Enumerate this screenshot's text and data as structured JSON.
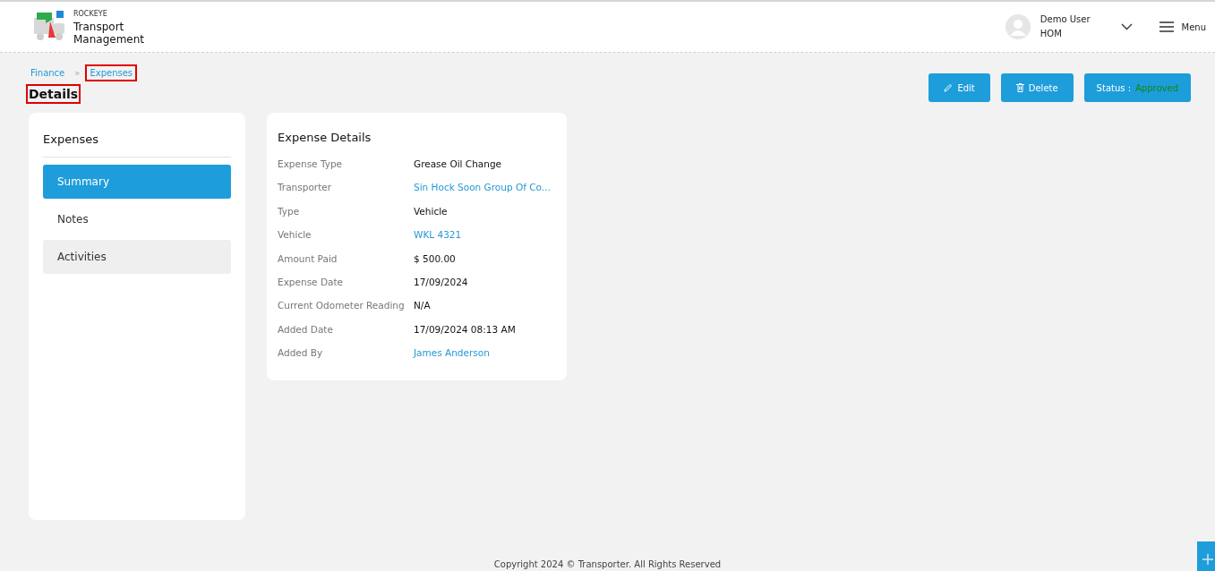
{
  "header": {
    "brand_small": "ROCKEYE",
    "brand_line1": "Transport",
    "brand_line2": "Management",
    "user_name": "Demo User",
    "user_role": "HOM",
    "menu_label": "Menu"
  },
  "breadcrumb_separator": "»",
  "breadcrumb": [
    {
      "label": "Finance",
      "highlighted": false
    },
    {
      "label": "Expenses",
      "highlighted": true
    }
  ],
  "page_title": {
    "text": "Details",
    "highlighted": true
  },
  "actions": {
    "edit": "Edit",
    "delete": "Delete",
    "status_label": "Status :",
    "status_value": "Approved"
  },
  "sidebar": {
    "title": "Expenses",
    "items": [
      {
        "label": "Summary",
        "selected": true,
        "shaded": false
      },
      {
        "label": "Notes",
        "selected": false,
        "shaded": false
      },
      {
        "label": "Activities",
        "selected": false,
        "shaded": true
      }
    ]
  },
  "details": {
    "title": "Expense Details",
    "rows": [
      {
        "label": "Expense Type",
        "value": "Grease Oil Change",
        "kind": "text"
      },
      {
        "label": "Transporter",
        "value": "Sin Hock Soon Group Of Co...",
        "kind": "link"
      },
      {
        "label": "Type",
        "value": "Vehicle",
        "kind": "text"
      },
      {
        "label": "Vehicle",
        "value": "WKL 4321",
        "kind": "link"
      },
      {
        "label": "Amount Paid",
        "value": "$ 500.00",
        "kind": "text"
      },
      {
        "label": "Expense Date",
        "value": "17/09/2024",
        "kind": "text"
      },
      {
        "label": "Current Odometer Reading",
        "value": "N/A",
        "kind": "text"
      },
      {
        "label": "Added Date",
        "value": "17/09/2024 08:13 AM",
        "kind": "text"
      },
      {
        "label": "Added By",
        "value": "James Anderson",
        "kind": "link"
      }
    ]
  },
  "footer": "Copyright 2024 © Transporter. All Rights Reserved"
}
